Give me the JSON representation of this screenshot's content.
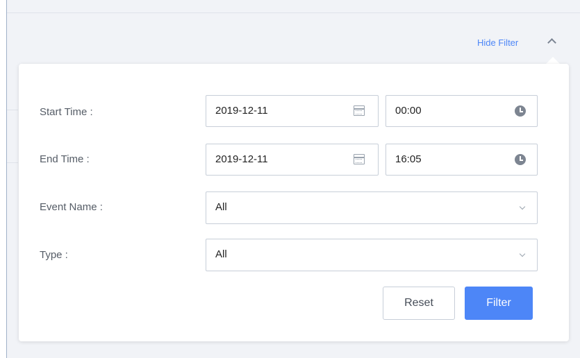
{
  "header": {
    "toggle_label": "Hide Filter"
  },
  "filter": {
    "start_time_label": "Start Time :",
    "end_time_label": "End Time :",
    "event_name_label": "Event Name :",
    "type_label": "Type :",
    "start_date": "2019-12-11",
    "start_time": "00:00",
    "end_date": "2019-12-11",
    "end_time": "16:05",
    "event_name_value": "All",
    "type_value": "All",
    "reset_label": "Reset",
    "filter_label": "Filter"
  },
  "colors": {
    "accent": "#4d86f7",
    "border": "#c7ced8",
    "background": "#f1f3f7"
  },
  "icons": {
    "date": "calendar-icon",
    "time": "clock-icon",
    "dropdown": "chevron-down-icon",
    "toggle": "chevron-up-icon"
  }
}
